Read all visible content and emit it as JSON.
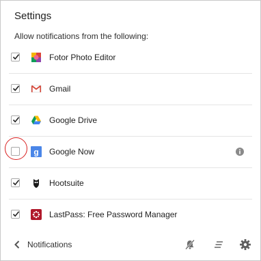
{
  "header": {
    "title": "Settings",
    "subtitle": "Allow notifications from the following:"
  },
  "apps": [
    {
      "name": "Fotor Photo Editor",
      "checked": true,
      "icon": "fotor-icon"
    },
    {
      "name": "Gmail",
      "checked": true,
      "icon": "gmail-icon"
    },
    {
      "name": "Google Drive",
      "checked": true,
      "icon": "google-drive-icon"
    },
    {
      "name": "Google Now",
      "checked": false,
      "icon": "google-now-icon",
      "has_info": true
    },
    {
      "name": "Hootsuite",
      "checked": true,
      "icon": "hootsuite-icon"
    },
    {
      "name": "LastPass: Free Password Manager",
      "checked": true,
      "icon": "lastpass-icon"
    }
  ],
  "footer": {
    "back_label": "Notifications",
    "icons": [
      "mute-notifications-icon",
      "clear-all-icon",
      "gear-icon"
    ]
  },
  "colors": {
    "highlight": "#d92020",
    "gmail_red": "#d44638",
    "lastpass_red": "#b0182a",
    "google_now_blue": "#4a86e8"
  }
}
